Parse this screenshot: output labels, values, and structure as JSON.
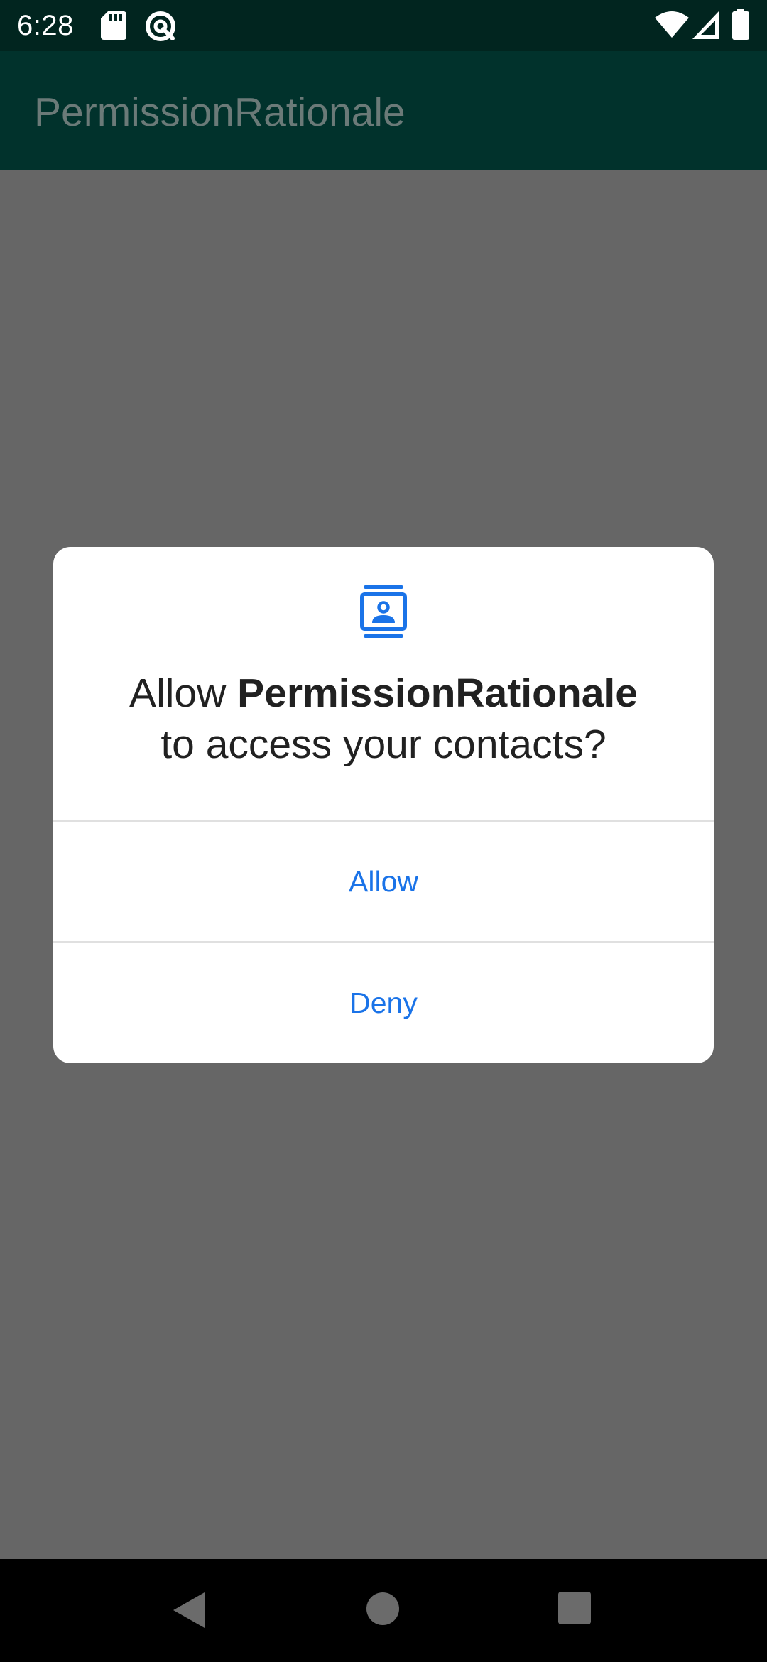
{
  "status_bar": {
    "time": "6:28",
    "left_icons": [
      "sd-card-icon",
      "at-sign-icon"
    ],
    "right_icons": [
      "wifi-icon",
      "cellular-signal-icon",
      "battery-icon"
    ]
  },
  "app_bar": {
    "title": "PermissionRationale"
  },
  "dialog": {
    "icon": "contacts-icon",
    "message_prefix": "Allow ",
    "app_name": "PermissionRationale",
    "message_suffix": "to access your contacts?",
    "buttons": {
      "allow": "Allow",
      "deny": "Deny"
    },
    "accent_color": "#1a73e8"
  },
  "navigation_bar": {
    "buttons": [
      "back-icon",
      "home-icon",
      "recents-icon"
    ]
  },
  "colors": {
    "status_bar": "#01251f",
    "app_bar": "#01322c",
    "scrim": "#666666",
    "dialog_background": "#ffffff",
    "nav_bar": "#000000"
  }
}
